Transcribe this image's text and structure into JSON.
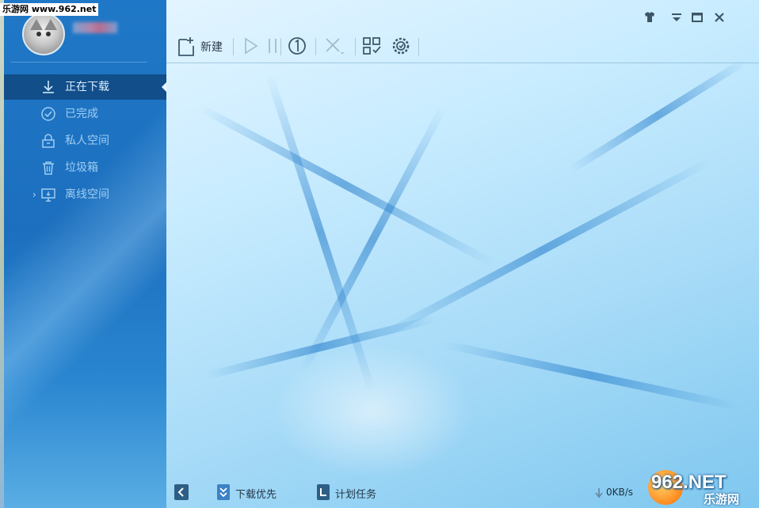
{
  "watermark": {
    "site": "乐游网 www.962.net",
    "logo_top": "962.NET",
    "logo_bottom": "乐游网"
  },
  "colors": {
    "accent": "#1c6fbe",
    "active_bg": "#114e8a",
    "nav_text": "#9fcdf3"
  },
  "sidebar": {
    "items": [
      {
        "label": "正在下载",
        "icon": "download-arrow-icon",
        "active": true
      },
      {
        "label": "已完成",
        "icon": "check-circle-icon",
        "active": false
      },
      {
        "label": "私人空间",
        "icon": "lock-icon",
        "active": false
      },
      {
        "label": "垃圾箱",
        "icon": "trash-icon",
        "active": false
      },
      {
        "label": "离线空间",
        "icon": "offline-monitor-icon",
        "active": false,
        "expandable": true
      }
    ]
  },
  "toolbar": {
    "new_label": "新建",
    "icons": [
      "new-file-icon",
      "play-icon",
      "pause-icon",
      "one-task-icon",
      "delete-icon",
      "grid-view-icon",
      "settings-gear-icon"
    ]
  },
  "window_controls": [
    "skin-shirt-icon",
    "menu-dropdown-icon",
    "minimize-icon",
    "close-icon"
  ],
  "statusbar": {
    "priority_label": "下载优先",
    "schedule_label": "计划任务",
    "speed": "0KB/s"
  }
}
